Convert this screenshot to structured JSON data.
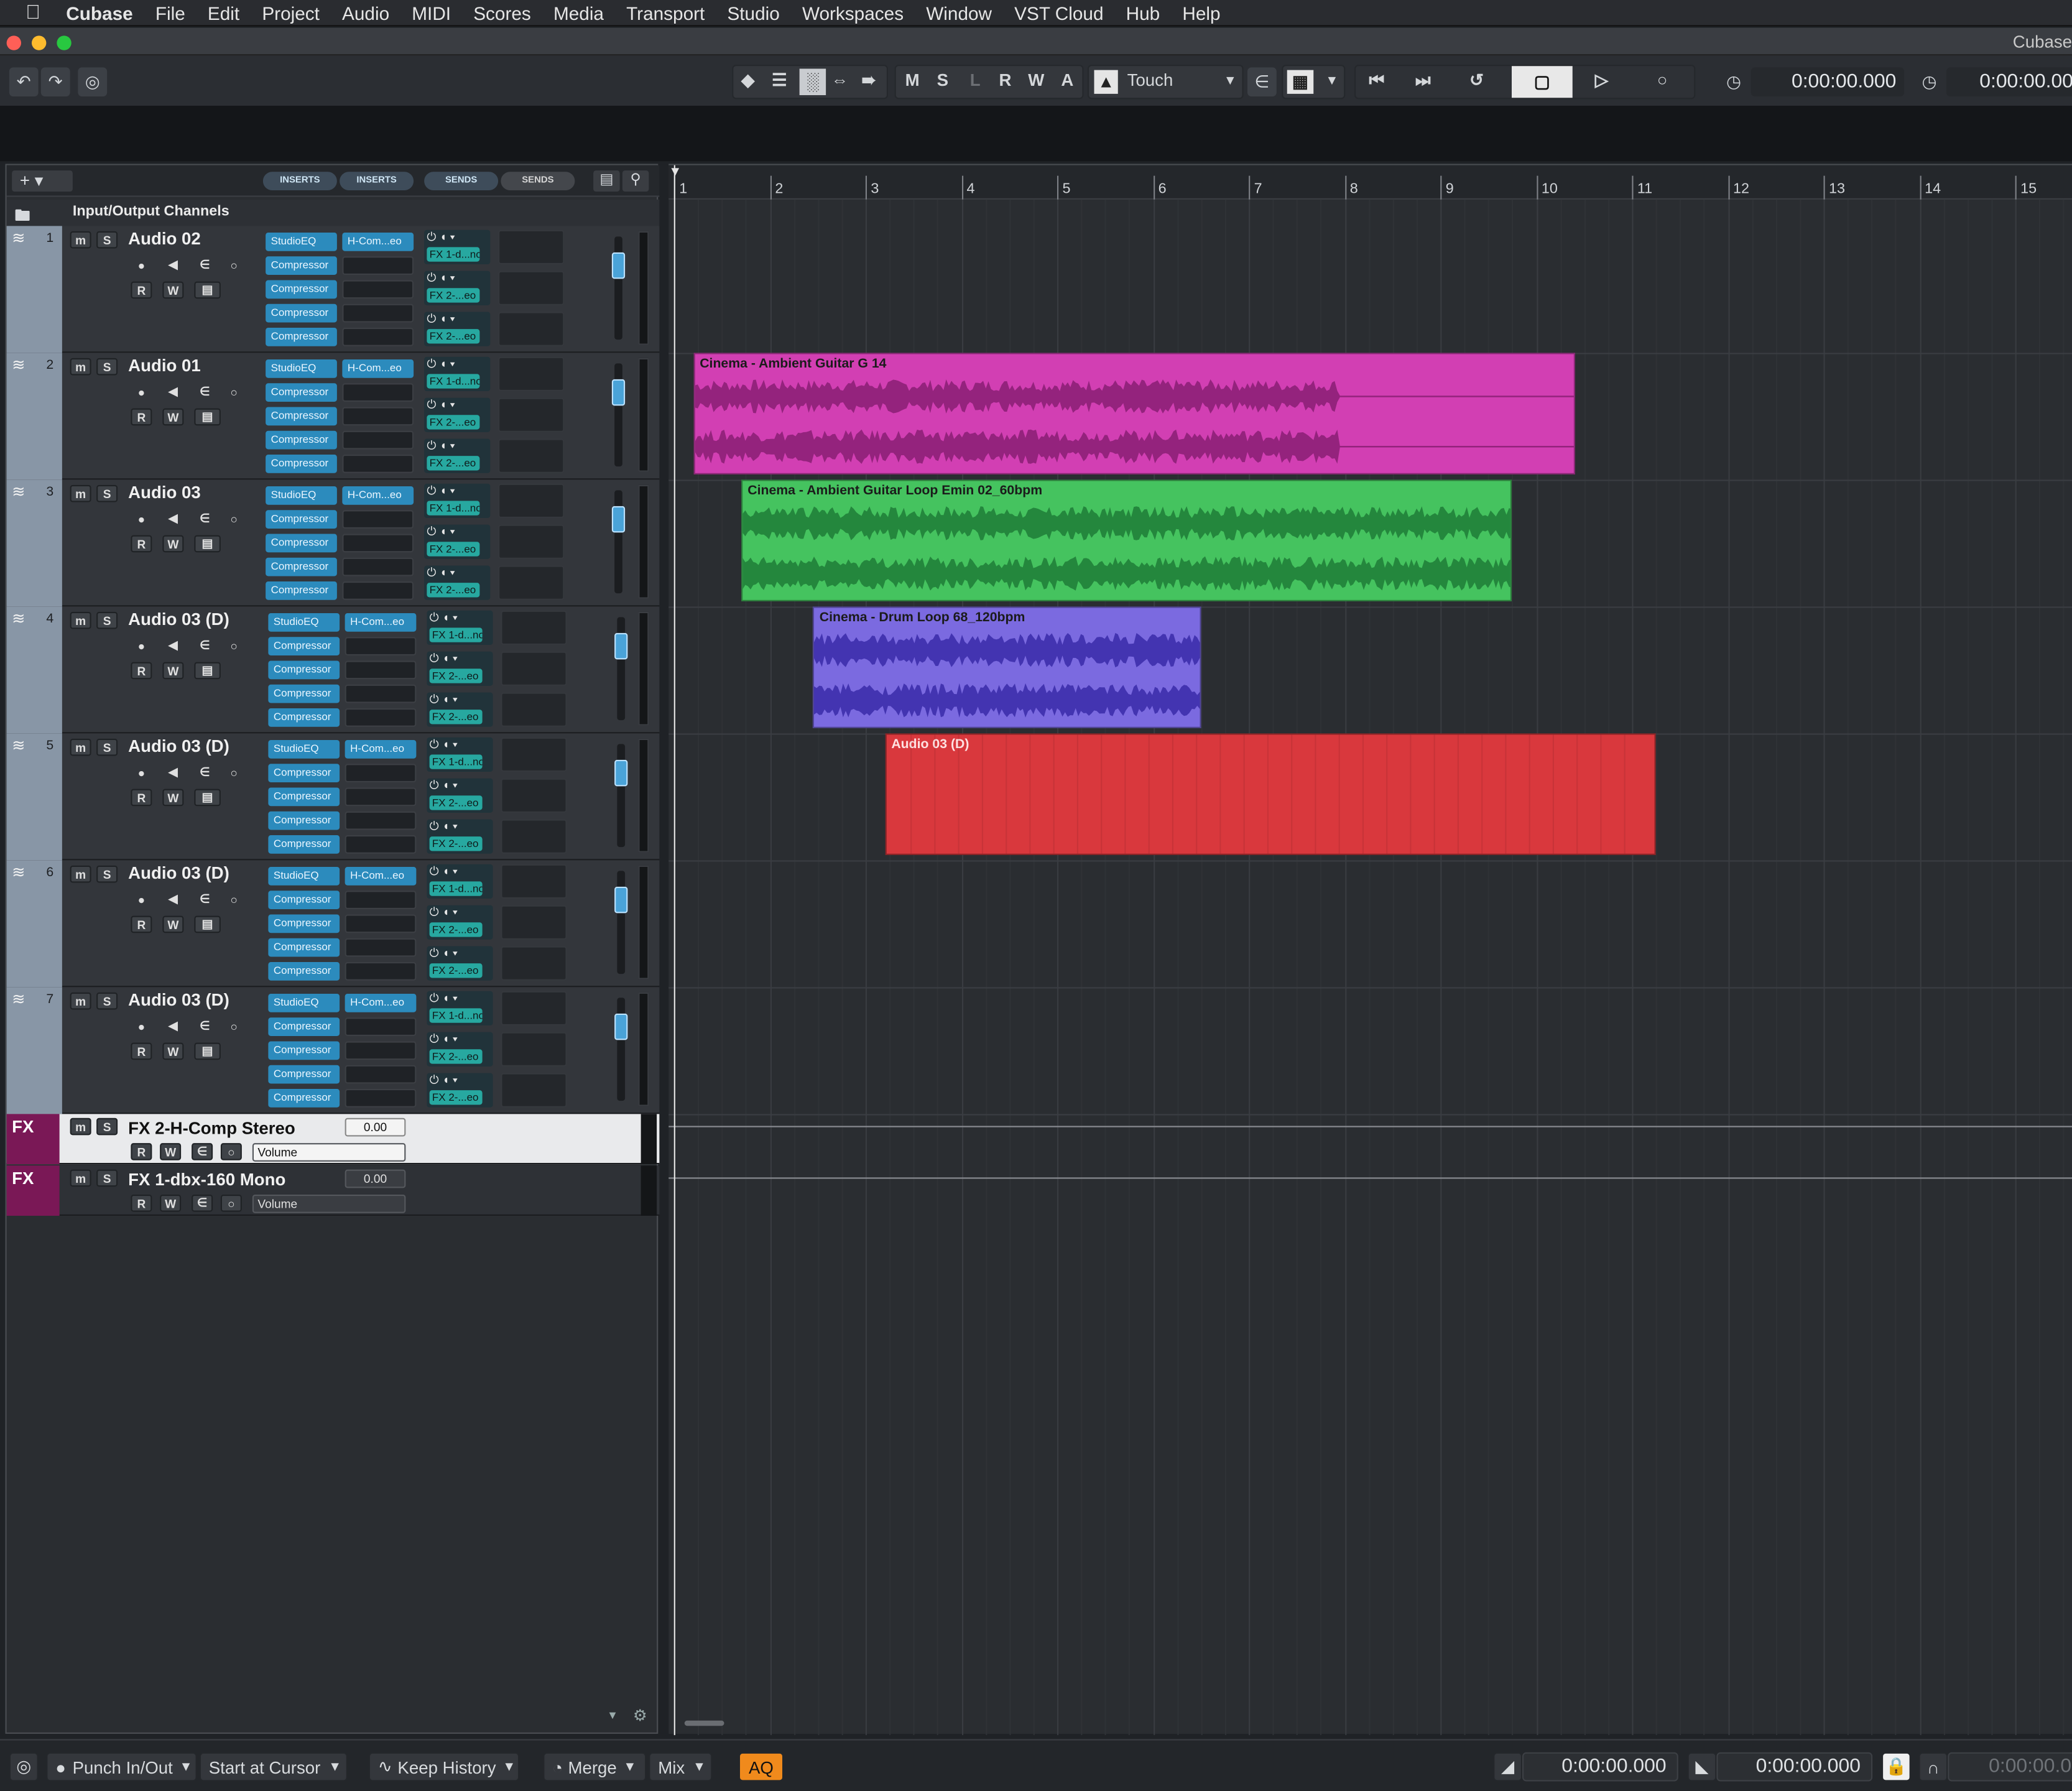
{
  "menubar": {
    "app_name": "Cubase",
    "items": [
      "File",
      "Edit",
      "Project",
      "Audio",
      "MIDI",
      "Scores",
      "Media",
      "Transport",
      "Studio",
      "Workspaces",
      "Window",
      "VST Cloud",
      "Hub",
      "Help"
    ]
  },
  "window": {
    "title": "Cubase"
  },
  "toolbar": {
    "mute_label": "M",
    "solo_label": "S",
    "l_label": "L",
    "r_label": "R",
    "w_label": "W",
    "a_label": "A",
    "automation_mode": "Touch",
    "time_primary": "0:00:00.000",
    "time_secondary": "0:00:00.00"
  },
  "tracklist": {
    "tabs": [
      "INSERTS",
      "INSERTS",
      "SENDS",
      "SENDS"
    ],
    "io_channels_label": "Input/Output Channels",
    "tracks": [
      {
        "number": "1",
        "name": "Audio 02",
        "inserts": [
          "StudioEQ",
          "Compressor",
          "Compressor",
          "Compressor",
          "Compressor"
        ],
        "insert2": "H-Com...eo",
        "sends": [
          "FX 1-d...no",
          "FX 2-...eo",
          "FX 2-...eo"
        ],
        "fader": 0.8
      },
      {
        "number": "2",
        "name": "Audio 01",
        "inserts": [
          "StudioEQ",
          "Compressor",
          "Compressor",
          "Compressor",
          "Compressor"
        ],
        "insert2": "H-Com...eo",
        "sends": [
          "FX 1-d...no",
          "FX 2-...eo",
          "FX 2-...eo"
        ],
        "fader": 0.8
      },
      {
        "number": "3",
        "name": "Audio 03",
        "inserts": [
          "StudioEQ",
          "Compressor",
          "Compressor",
          "Compressor",
          "Compressor"
        ],
        "insert2": "H-Com...eo",
        "sends": [
          "FX 1-d...no",
          "FX 2-...eo",
          "FX 2-...eo"
        ],
        "fader": 0.8
      },
      {
        "number": "4",
        "name": "Audio 03 (D)",
        "inserts": [
          "StudioEQ",
          "Compressor",
          "Compressor",
          "Compressor",
          "Compressor"
        ],
        "insert2": "H-Com...eo",
        "sends": [
          "FX 1-d...no",
          "FX 2-...eo",
          "FX 2-...eo"
        ],
        "fader": 0.8
      },
      {
        "number": "5",
        "name": "Audio 03 (D)",
        "inserts": [
          "StudioEQ",
          "Compressor",
          "Compressor",
          "Compressor",
          "Compressor"
        ],
        "insert2": "H-Com...eo",
        "sends": [
          "FX 1-d...no",
          "FX 2-...eo",
          "FX 2-...eo"
        ],
        "fader": 0.8
      },
      {
        "number": "6",
        "name": "Audio 03 (D)",
        "inserts": [
          "StudioEQ",
          "Compressor",
          "Compressor",
          "Compressor",
          "Compressor"
        ],
        "insert2": "H-Com...eo",
        "sends": [
          "FX 1-d...no",
          "FX 2-...eo",
          "FX 2-...eo"
        ],
        "fader": 0.8
      },
      {
        "number": "7",
        "name": "Audio 03 (D)",
        "inserts": [
          "StudioEQ",
          "Compressor",
          "Compressor",
          "Compressor",
          "Compressor"
        ],
        "insert2": "H-Com...eo",
        "sends": [
          "FX 1-d...no",
          "FX 2-...eo",
          "FX 2-...eo"
        ],
        "fader": 0.8
      }
    ],
    "fx_tracks": [
      {
        "label": "FX",
        "name": "FX 2-H-Comp Stereo",
        "value": "0.00",
        "param": "Volume",
        "selected": true
      },
      {
        "label": "FX",
        "name": "FX 1-dbx-160 Mono",
        "value": "0.00",
        "param": "Volume",
        "selected": false
      }
    ],
    "btn": {
      "m": "m",
      "s": "S",
      "r": "R",
      "w": "W"
    }
  },
  "ruler": {
    "bars": [
      "1",
      "2",
      "3",
      "4",
      "5",
      "6",
      "7",
      "8",
      "9",
      "10",
      "11",
      "12",
      "13",
      "14",
      "15"
    ]
  },
  "clips": [
    {
      "name": "Cinema - Ambient Guitar  G 14",
      "track": 2,
      "start_bar": 1.2,
      "end_bar": 10.4,
      "color": "#d23fb3",
      "wave": "#8a1e73"
    },
    {
      "name": "Cinema - Ambient Guitar Loop Emin  02_60bpm",
      "track": 3,
      "start_bar": 1.7,
      "end_bar": 9.75,
      "color": "#45c35f",
      "wave": "#1f7d37"
    },
    {
      "name": "Cinema - Drum Loop 68_120bpm",
      "track": 4,
      "start_bar": 2.45,
      "end_bar": 6.5,
      "color": "#7b6ae0",
      "wave": "#3a2aa8"
    },
    {
      "name": "Audio 03 (D)",
      "track": 5,
      "start_bar": 3.2,
      "end_bar": 11.25,
      "color": "#d9383d",
      "wave": "#d9383d"
    }
  ],
  "statusbar": {
    "punch": "Punch In/Out",
    "start": "Start at Cursor",
    "history": "Keep History",
    "merge": "Merge",
    "mix": "Mix",
    "aq": "AQ",
    "locator_left": "0:00:00.000",
    "locator_right": "0:00:00.000",
    "locator_third": "0:00:00.0"
  },
  "colors": {
    "accent": "#2c8bbd",
    "send": "#27a8a0",
    "fx_strip": "#7a1856",
    "aq": "#f08a1c"
  }
}
